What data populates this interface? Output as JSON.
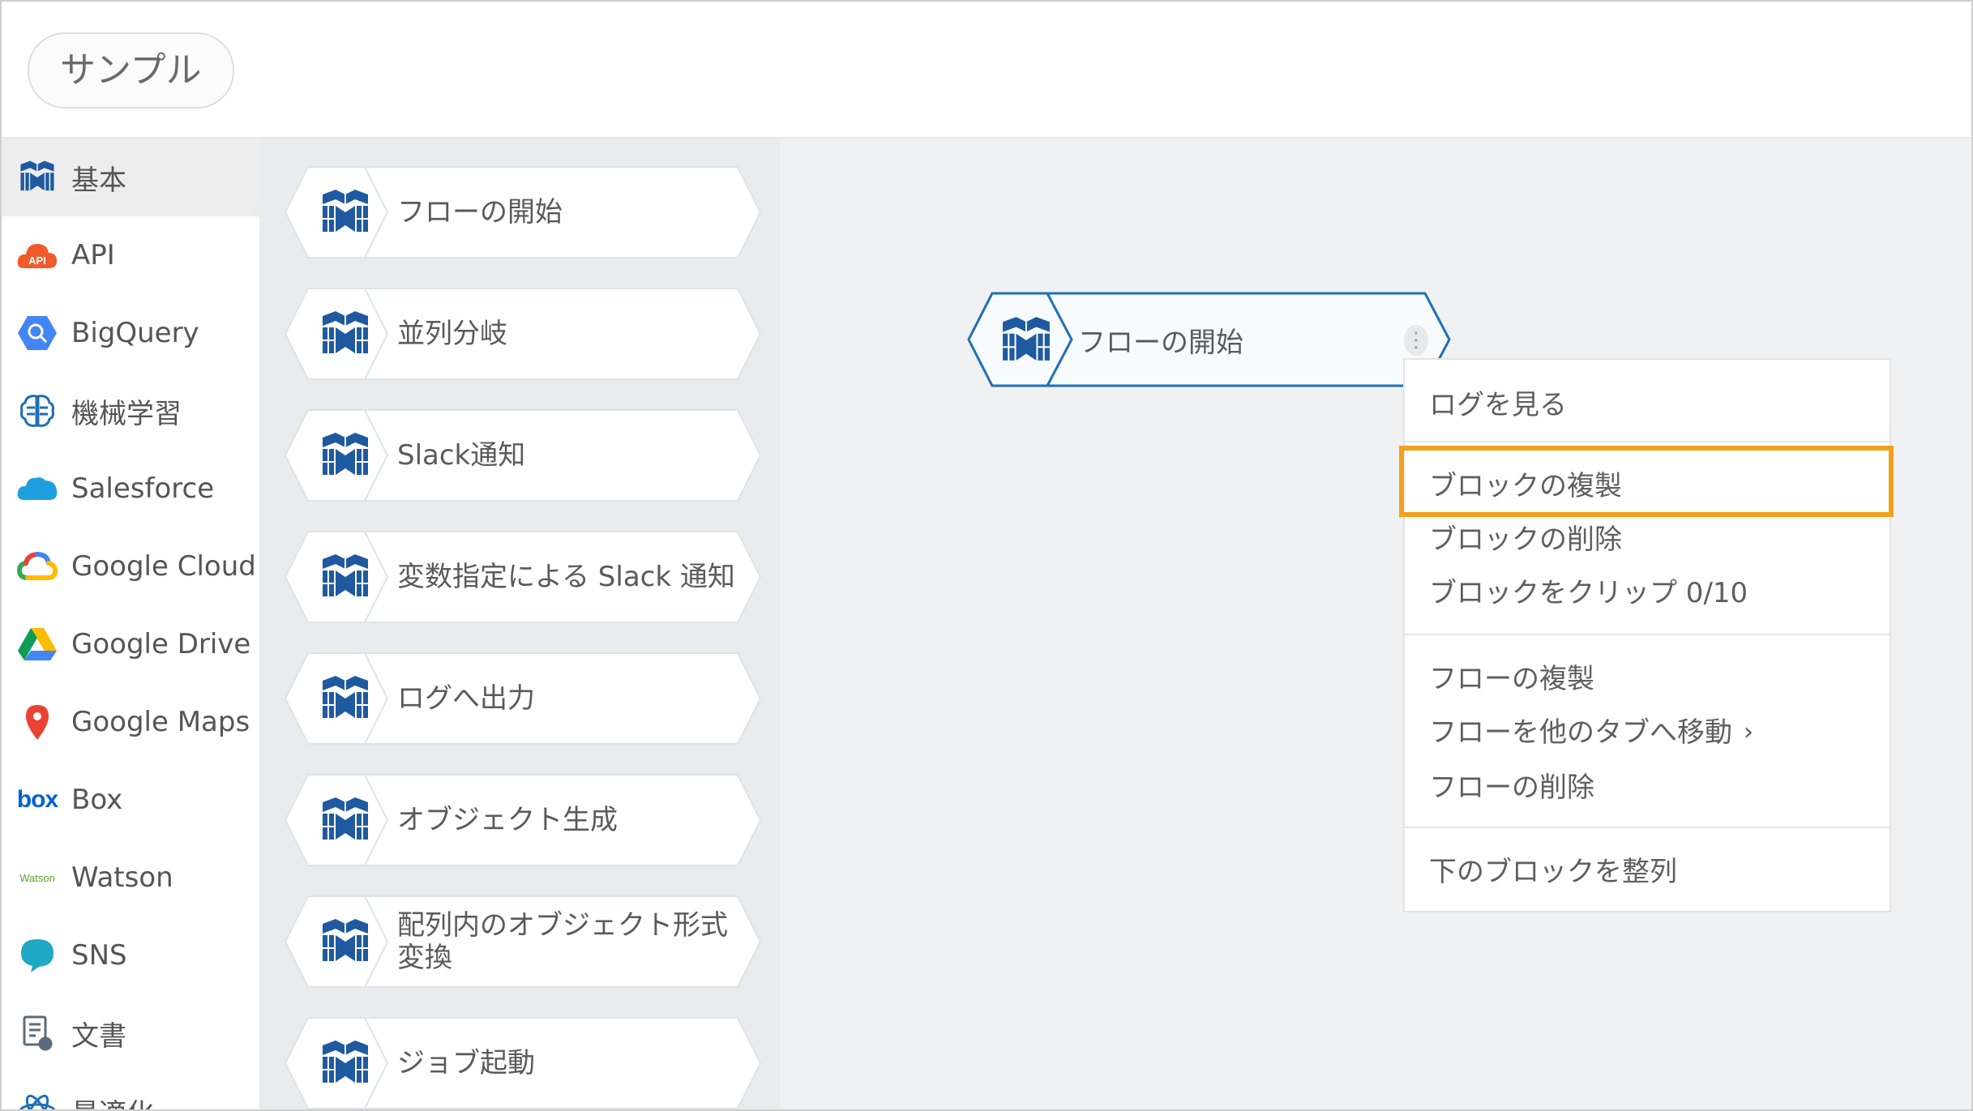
{
  "header": {
    "tab_label": "サンプル"
  },
  "sidebar": {
    "categories": [
      {
        "label": "基本",
        "icon": "block-cube-icon"
      },
      {
        "label": "API",
        "icon": "api-cloud-icon"
      },
      {
        "label": "BigQuery",
        "icon": "bigquery-icon"
      },
      {
        "label": "機械学習",
        "icon": "brain-icon"
      },
      {
        "label": "Salesforce",
        "icon": "salesforce-cloud-icon"
      },
      {
        "label": "Google Cloud",
        "icon": "google-cloud-icon"
      },
      {
        "label": "Google Drive",
        "icon": "google-drive-icon"
      },
      {
        "label": "Google Maps",
        "icon": "map-pin-icon"
      },
      {
        "label": "Box",
        "icon": "box-logo-icon"
      },
      {
        "label": "Watson",
        "icon": "watson-logo-icon"
      },
      {
        "label": "SNS",
        "icon": "chat-bubble-icon"
      },
      {
        "label": "文書",
        "icon": "document-icon"
      },
      {
        "label": "最適化",
        "icon": "atom-icon"
      }
    ],
    "box_logo_text": "box",
    "watson_logo_text": "Watson",
    "api_icon_text": "API"
  },
  "palette": {
    "blocks": [
      {
        "label": "フローの開始"
      },
      {
        "label": "並列分岐"
      },
      {
        "label": "Slack通知"
      },
      {
        "label": "変数指定による Slack 通知"
      },
      {
        "label": "ログへ出力"
      },
      {
        "label": "オブジェクト生成"
      },
      {
        "label": "配列内のオブジェクト形式変換"
      },
      {
        "label": "ジョブ起動"
      }
    ]
  },
  "canvas": {
    "block_label": "フローの開始",
    "kebab": "⋮"
  },
  "context_menu": {
    "items": [
      "ログを見る",
      "ブロックの複製",
      "ブロックの削除",
      "ブロックをクリップ 0/10",
      "フローの複製",
      "フローを他のタブへ移動",
      "フローの削除",
      "下のブロックを整列"
    ],
    "submenu_chevron": "›",
    "highlight_color": "#f0a21b"
  },
  "colors": {
    "block_blue": "#1f5aa0",
    "selected_outline": "#1f6fb5"
  }
}
